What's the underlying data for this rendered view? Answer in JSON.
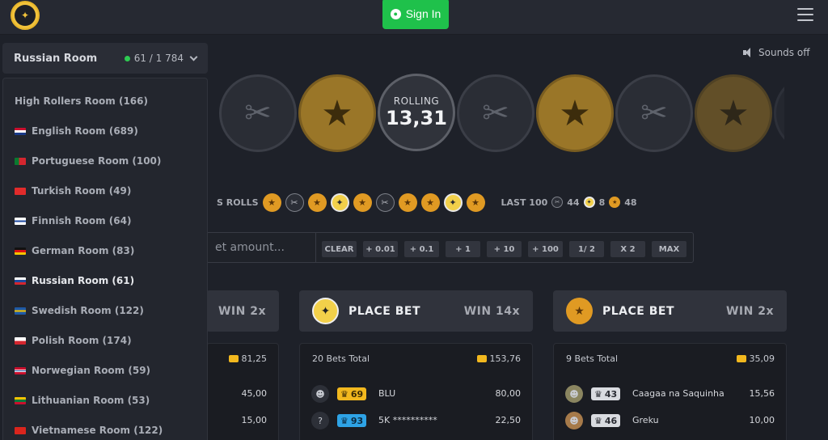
{
  "header": {
    "sign_in_label": "Sign In"
  },
  "room_selector": {
    "current": "Russian Room",
    "online": "61 / 1 784"
  },
  "rooms": [
    {
      "label": "High Rollers Room (166)",
      "flag": ""
    },
    {
      "label": "English Room (689)",
      "flag": "gb"
    },
    {
      "label": "Portuguese Room (100)",
      "flag": "pt"
    },
    {
      "label": "Turkish Room (49)",
      "flag": "tr"
    },
    {
      "label": "Finnish Room (64)",
      "flag": "fi"
    },
    {
      "label": "German Room (83)",
      "flag": "de"
    },
    {
      "label": "Russian Room (61)",
      "flag": "ru"
    },
    {
      "label": "Swedish Room (122)",
      "flag": "se"
    },
    {
      "label": "Polish Room (174)",
      "flag": "pl"
    },
    {
      "label": "Norwegian Room (59)",
      "flag": "no"
    },
    {
      "label": "Lithuanian Room (53)",
      "flag": "lt"
    },
    {
      "label": "Vietnamese Room (122)",
      "flag": "vn"
    }
  ],
  "sounds_label": "Sounds off",
  "roll": {
    "label": "ROLLING",
    "value": "13,31"
  },
  "previous_rolls": {
    "label": "S ROLLS",
    "last100_label": "LAST 100",
    "last100_ct": "44",
    "last100_gold": "8",
    "last100_t": "48"
  },
  "bet_controls": {
    "input_placeholder": "et amount...",
    "buttons": [
      "CLEAR",
      "+ 0.01",
      "+ 0.1",
      "+ 1",
      "+ 10",
      "+ 100",
      "1/ 2",
      "X 2",
      "MAX"
    ]
  },
  "panels": [
    {
      "title": "",
      "win": "WIN 2x",
      "bets_total": "",
      "sum": "81,25",
      "rows": [
        {
          "name": "",
          "level": "",
          "amount": "45,00"
        },
        {
          "name": "",
          "level": "",
          "amount": "15,00"
        }
      ]
    },
    {
      "title": "PLACE BET",
      "win": "WIN 14x",
      "bets_total": "20 Bets Total",
      "sum": "153,76",
      "rows": [
        {
          "name": "BLU",
          "level": "69",
          "amount": "80,00"
        },
        {
          "name": "5K **********",
          "level": "93",
          "amount": "22,50"
        }
      ]
    },
    {
      "title": "PLACE BET",
      "win": "WIN 2x",
      "bets_total": "9 Bets Total",
      "sum": "35,09",
      "rows": [
        {
          "name": "Caagaa na Saquinha",
          "level": "43",
          "amount": "15,56"
        },
        {
          "name": "Greku",
          "level": "46",
          "amount": "10,00"
        }
      ]
    }
  ],
  "colors": {
    "accent_green": "#1fc14b",
    "t_coin": "#e09a23",
    "gold": "#f2d04a"
  }
}
